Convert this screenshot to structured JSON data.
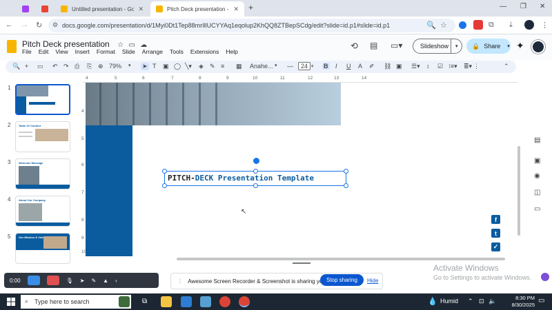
{
  "browser": {
    "tabs": [
      {
        "label": "",
        "active": false
      },
      {
        "label": "",
        "active": false
      },
      {
        "label": "Untitled presentation - Google",
        "active": false
      },
      {
        "label": "Pitch Deck presentation - Goog",
        "active": true
      }
    ],
    "url": "docs.google.com/presentation/d/1Myi0Dt1Tep88mrIllUCYYAq1eqolup2KhQQ8ZTBepSCdg/edit?slide=id.p1#slide=id.p1"
  },
  "doc": {
    "title": "Pitch Deck presentation",
    "menu": [
      "File",
      "Edit",
      "View",
      "Insert",
      "Format",
      "Slide",
      "Arrange",
      "Tools",
      "Extensions",
      "Help"
    ],
    "slideshow_label": "Slideshow",
    "share_label": "Share"
  },
  "toolbar": {
    "zoom": "79%",
    "font": "Anahe...",
    "font_size": "24"
  },
  "ruler": {
    "h": [
      "4",
      "5",
      "6",
      "7",
      "8",
      "9",
      "10",
      "11",
      "12",
      "13",
      "14"
    ],
    "v": [
      "4",
      "5",
      "6",
      "7",
      "8",
      "9",
      "10"
    ]
  },
  "slides": [
    {
      "num": "1",
      "caption": ""
    },
    {
      "num": "2",
      "caption": "Table Of Content"
    },
    {
      "num": "3",
      "caption": "Welcome Message"
    },
    {
      "num": "4",
      "caption": "About Our Company"
    },
    {
      "num": "5",
      "caption": "Our Mission & Vision"
    }
  ],
  "canvas": {
    "title_part1": "PITCH-",
    "title_part2": "DECK Presentation Template",
    "colors": {
      "accent": "#0a5c9f",
      "dark": "#1a1a1a"
    }
  },
  "recorder": {
    "time": "0:00",
    "sharing_text": "Awesome Screen Recorder & Screenshot is sharing your screen.",
    "stop_label": "Stop sharing",
    "hide_label": "Hide"
  },
  "watermark": {
    "line1": "Activate Windows",
    "line2": "Go to Settings to activate Windows."
  },
  "taskbar": {
    "search_placeholder": "Type here to search",
    "weather": "Humid",
    "time": "8:30 PM",
    "date": "8/30/2025"
  }
}
